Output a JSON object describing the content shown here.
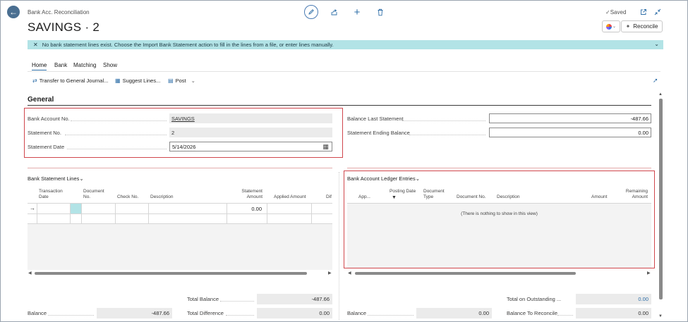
{
  "header": {
    "back_icon": "arrow-left-icon",
    "page_type": "Bank Acc. Reconciliation",
    "title": "SAVINGS · 2",
    "status": "Saved",
    "reconcile_label": "Reconcile"
  },
  "notification": {
    "text": "No bank statement lines exist. Choose the Import Bank Statement action to fill in the lines from a file, or enter lines manually."
  },
  "tabs": [
    {
      "label": "Home"
    },
    {
      "label": "Bank"
    },
    {
      "label": "Matching"
    },
    {
      "label": "Show"
    }
  ],
  "actions": {
    "transfer": "Transfer to General Journal...",
    "suggest": "Suggest Lines...",
    "post": "Post"
  },
  "general": {
    "title": "General",
    "bank_account_no_label": "Bank Account No.",
    "bank_account_no": "SAVINGS",
    "statement_no_label": "Statement No.",
    "statement_no": "2",
    "statement_date_label": "Statement Date",
    "statement_date": "5/14/2026",
    "balance_last_label": "Balance Last Statement",
    "balance_last": "-487.66",
    "ending_balance_label": "Statement Ending Balance",
    "ending_balance": "0.00"
  },
  "statement_lines": {
    "title": "Bank Statement Lines",
    "columns": [
      "Transaction Date",
      "Document No.",
      "Check No.",
      "Description",
      "Statement Amount",
      "Applied Amount",
      "Dif"
    ],
    "row_amount": "0.00"
  },
  "ledger_entries": {
    "title": "Bank Account Ledger Entries",
    "columns": [
      "App...",
      "Posting Date",
      "Document Type",
      "Document No.",
      "Description",
      "Amount",
      "Remaining Amount"
    ],
    "empty_text": "(There is nothing to show in this view)"
  },
  "totals": {
    "total_balance_label": "Total Balance",
    "total_balance": "-487.66",
    "balance_label": "Balance",
    "balance": "-487.66",
    "total_difference_label": "Total Difference",
    "total_difference": "0.00",
    "right_balance_label": "Balance",
    "right_balance": "0.00",
    "outstanding_label": "Total on Outstanding ...",
    "outstanding": "0.00",
    "to_reconcile_label": "Balance To Reconcile",
    "to_reconcile": "0.00"
  }
}
